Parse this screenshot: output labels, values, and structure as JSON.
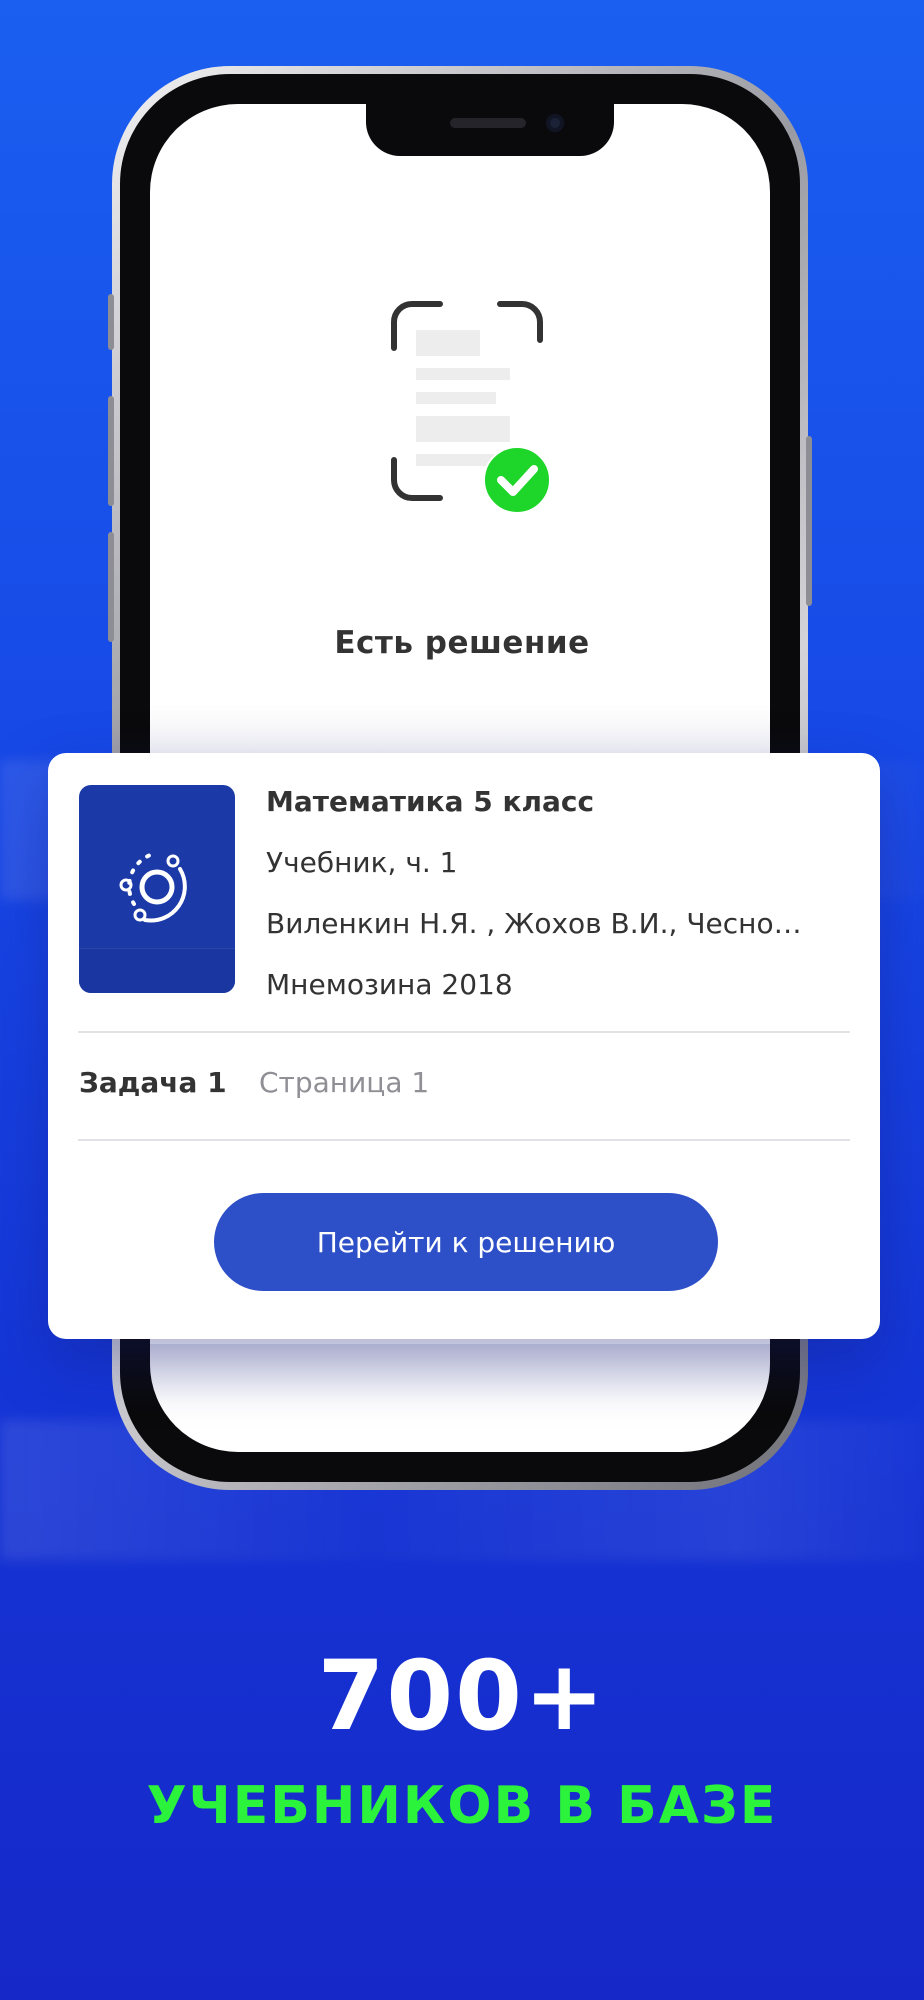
{
  "screen": {
    "title": "Есть решение"
  },
  "result_card": {
    "book": {
      "title": "Математика 5 класс",
      "type": "Учебник, ч. 1",
      "authors": "Виленкин Н.Я. , Жохов В.И., Чесно…",
      "publisher": "Мнемозина 2018",
      "cover_icon": "orbit-logo-icon"
    },
    "task_label": "Задача 1",
    "page_label": "Страница 1",
    "button_label": "Перейти к решению"
  },
  "promo": {
    "headline": "700+",
    "subline": "УЧЕБНИКОВ В БАЗЕ"
  },
  "colors": {
    "background": "#1747e6",
    "button": "#2d4fc8",
    "accent_green": "#2bf23a",
    "check_green": "#1ed52a",
    "cover": "#1b3aa8"
  },
  "icons": {
    "scan": "document-scan-icon",
    "check": "check-circle-icon"
  }
}
